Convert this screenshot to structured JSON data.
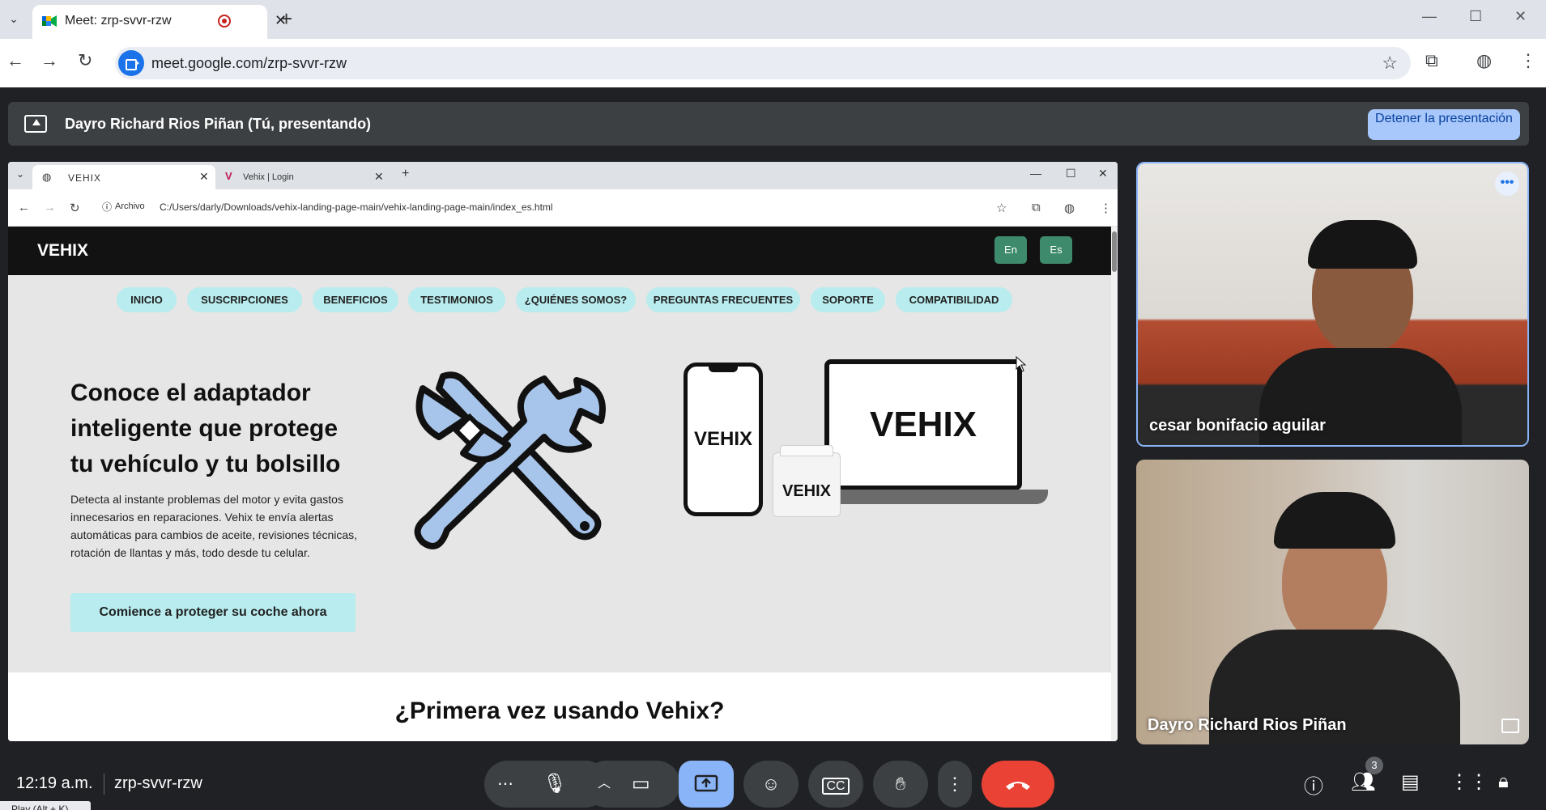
{
  "browser": {
    "tab_title": "Meet: zrp-svvr-rzw",
    "url": "meet.google.com/zrp-svvr-rzw"
  },
  "presenting": {
    "label": "Dayro Richard Rios Piñan (Tú, presentando)",
    "stop_button": "Detener la presentación"
  },
  "shared": {
    "tabs": [
      "VEHIX",
      "Vehix | Login"
    ],
    "file_label": "Archivo",
    "path": "C:/Users/darly/Downloads/vehix-landing-page-main/vehix-landing-page-main/index_es.html",
    "site": {
      "logo": "VEHIX",
      "lang_en": "En",
      "lang_es": "Es",
      "menu": [
        "INICIO",
        "SUSCRIPCIONES",
        "BENEFICIOS",
        "TESTIMONIOS",
        "¿QUIÉNES SOMOS?",
        "PREGUNTAS FRECUENTES",
        "SOPORTE",
        "COMPATIBILIDAD"
      ],
      "hero_title": "Conoce el adaptador inteligente que protege tu vehículo y tu bolsillo",
      "hero_text": "Detecta al instante problemas del motor y evita gastos innecesarios en reparaciones. Vehix te envía alertas automáticas para cambios de aceite, revisiones técnicas, rotación de llantas y más, todo desde tu celular.",
      "cta": "Comience a proteger su coche ahora",
      "phone_brand": "VEHIX",
      "laptop_brand": "VEHIX",
      "device_brand": "VEHIX",
      "section2_title": "¿Primera vez usando Vehix?"
    }
  },
  "participants": [
    {
      "name": "cesar bonifacio aguilar"
    },
    {
      "name": "Dayro Richard Rios Piñan"
    }
  ],
  "bottom_bar": {
    "time": "12:19 a.m.",
    "meeting_code": "zrp-svvr-rzw",
    "play_hint": "Play (Alt + K)",
    "participant_count": "3"
  },
  "colors": {
    "accent_blue": "#8ab4f8",
    "hangup_red": "#ea4335",
    "pill_cyan": "#b8ecee",
    "lang_green": "#3d8a6c"
  }
}
